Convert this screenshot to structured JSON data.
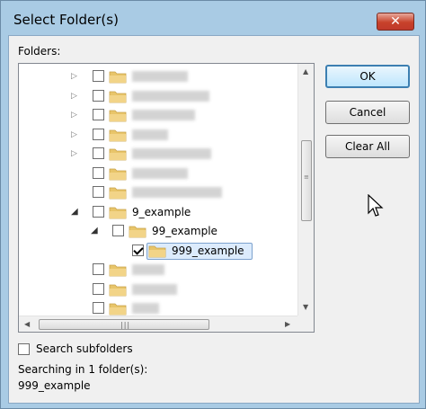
{
  "window": {
    "title": "Select Folder(s)",
    "close_glyph": "✕"
  },
  "labels": {
    "folders": "Folders:",
    "search_subfolders": "Search subfolders",
    "searching_in": "Searching in 1 folder(s):",
    "searching_target": "999_example"
  },
  "buttons": {
    "ok": "OK",
    "cancel": "Cancel",
    "clear_all": "Clear All"
  },
  "tree": {
    "items": [
      {
        "label": "",
        "level": 0,
        "expander": "collapsed",
        "checked": false
      },
      {
        "label": "",
        "level": 0,
        "expander": "collapsed",
        "checked": false
      },
      {
        "label": "",
        "level": 0,
        "expander": "collapsed",
        "checked": false
      },
      {
        "label": "",
        "level": 0,
        "expander": "collapsed",
        "checked": false
      },
      {
        "label": "",
        "level": 0,
        "expander": "collapsed",
        "checked": false
      },
      {
        "label": "",
        "level": 0,
        "expander": "none",
        "checked": false
      },
      {
        "label": "",
        "level": 0,
        "expander": "none",
        "checked": false
      },
      {
        "label": "9_example",
        "level": 0,
        "expander": "expanded",
        "checked": false
      },
      {
        "label": "99_example",
        "level": 1,
        "expander": "expanded",
        "checked": false
      },
      {
        "label": "999_example",
        "level": 2,
        "expander": "none",
        "checked": true,
        "selected": true
      },
      {
        "label": "",
        "level": 0,
        "expander": "none",
        "checked": false
      },
      {
        "label": "",
        "level": 0,
        "expander": "none",
        "checked": false
      },
      {
        "label": "",
        "level": 0,
        "expander": "none",
        "checked": false
      }
    ]
  },
  "search_subfolders_checked": false,
  "colors": {
    "folder": "#e8c56a",
    "selection_border": "#7da2ce",
    "selection_fill": "#dcebfc",
    "default_button_border": "#3c7fb1"
  },
  "icons": {
    "close": "close-icon",
    "expand": "triangle-right-icon",
    "collapse": "triangle-down-icon",
    "folder": "folder-icon",
    "cursor": "mouse-pointer-icon"
  }
}
